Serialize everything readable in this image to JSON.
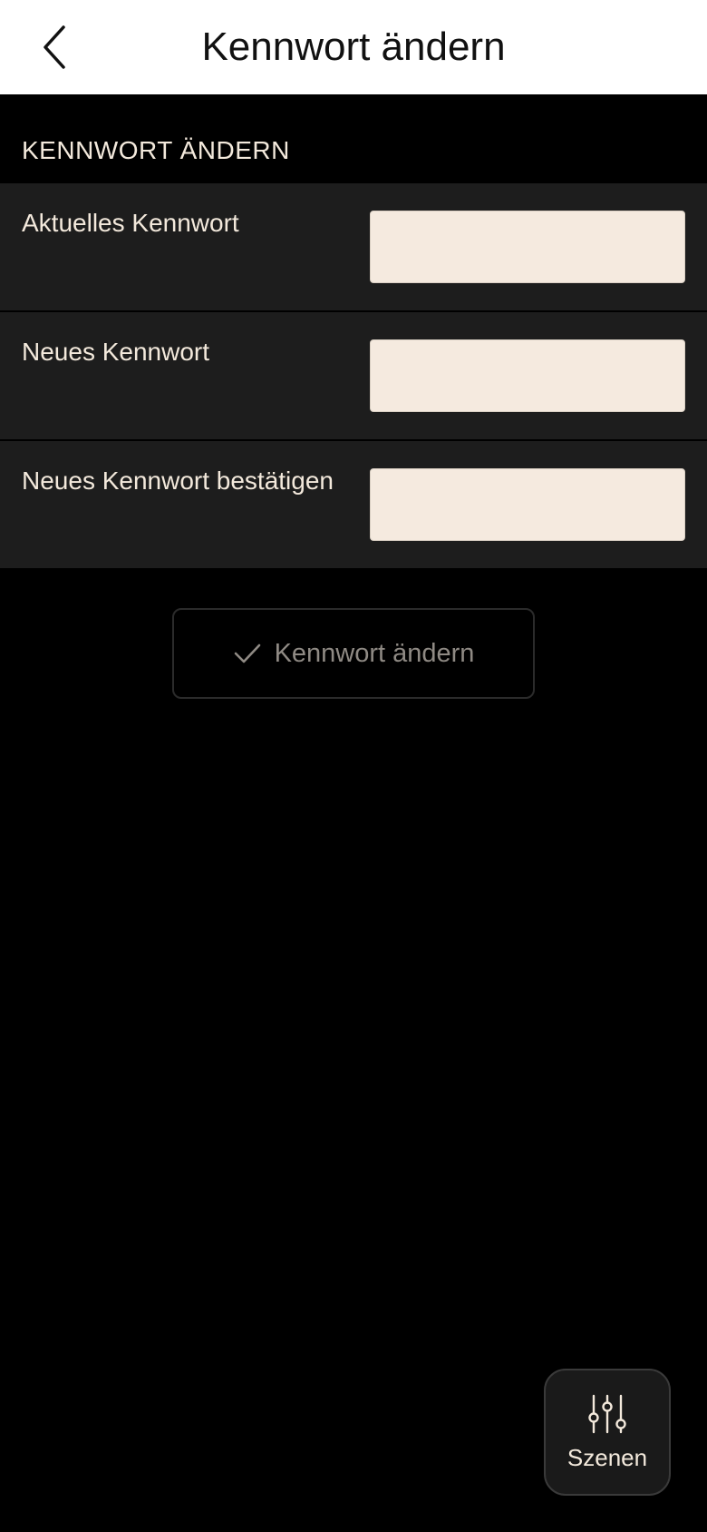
{
  "header": {
    "title": "Kennwort ändern",
    "back_icon": "chevron-left-icon"
  },
  "section": {
    "label": "KENNWORT ÄNDERN"
  },
  "form": {
    "fields": [
      {
        "label": "Aktuelles Kennwort",
        "value": ""
      },
      {
        "label": "Neues Kennwort",
        "value": ""
      },
      {
        "label": "Neues Kennwort bestätigen",
        "value": ""
      }
    ]
  },
  "submit": {
    "label": "Kennwort ändern",
    "icon": "check-icon"
  },
  "scenes": {
    "label": "Szenen",
    "icon": "sliders-icon"
  },
  "colors": {
    "background": "#000000",
    "header_background": "#ffffff",
    "row_background": "#1d1d1d",
    "input_background": "#f5eadf",
    "text_light": "#f3e9dc",
    "text_muted": "#8f8a84"
  }
}
